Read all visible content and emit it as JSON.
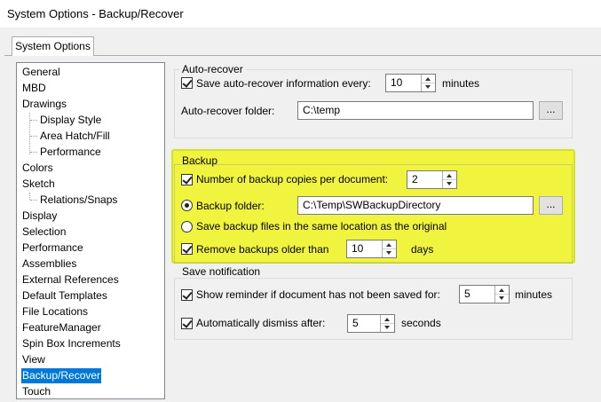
{
  "window": {
    "title": "System Options - Backup/Recover"
  },
  "tabs": [
    {
      "label": "System Options"
    }
  ],
  "tree": {
    "items": [
      {
        "label": "General"
      },
      {
        "label": "MBD"
      },
      {
        "label": "Drawings"
      },
      {
        "label": "Display Style"
      },
      {
        "label": "Area Hatch/Fill"
      },
      {
        "label": "Performance"
      },
      {
        "label": "Colors"
      },
      {
        "label": "Sketch"
      },
      {
        "label": "Relations/Snaps"
      },
      {
        "label": "Display"
      },
      {
        "label": "Selection"
      },
      {
        "label": "Performance"
      },
      {
        "label": "Assemblies"
      },
      {
        "label": "External References"
      },
      {
        "label": "Default Templates"
      },
      {
        "label": "File Locations"
      },
      {
        "label": "FeatureManager"
      },
      {
        "label": "Spin Box Increments"
      },
      {
        "label": "View"
      },
      {
        "label": "Backup/Recover"
      },
      {
        "label": "Touch"
      }
    ],
    "selected": "Backup/Recover"
  },
  "auto_recover": {
    "group_label": "Auto-recover",
    "save_label": "Save auto-recover information every:",
    "save_checked": true,
    "interval": "10",
    "interval_unit": "minutes",
    "folder_label": "Auto-recover folder:",
    "folder_value": "C:\\temp",
    "browse_label": "..."
  },
  "backup": {
    "group_label": "Backup",
    "copies_label": "Number of backup copies per document:",
    "copies_checked": true,
    "copies_value": "2",
    "folder_radio_label": "Backup folder:",
    "folder_value": "C:\\Temp\\SWBackupDirectory",
    "browse_label": "...",
    "same_location_label": "Save backup files in the same location as the original",
    "remove_label": "Remove backups older than",
    "remove_checked": true,
    "remove_value": "10",
    "remove_unit": "days",
    "highlight_color": "#f0f51e"
  },
  "save_notification": {
    "group_label": "Save notification",
    "reminder_label": "Show reminder if document has not been saved for:",
    "reminder_checked": true,
    "reminder_value": "5",
    "reminder_unit": "minutes",
    "dismiss_label": "Automatically dismiss after:",
    "dismiss_checked": true,
    "dismiss_value": "5",
    "dismiss_unit": "seconds"
  }
}
